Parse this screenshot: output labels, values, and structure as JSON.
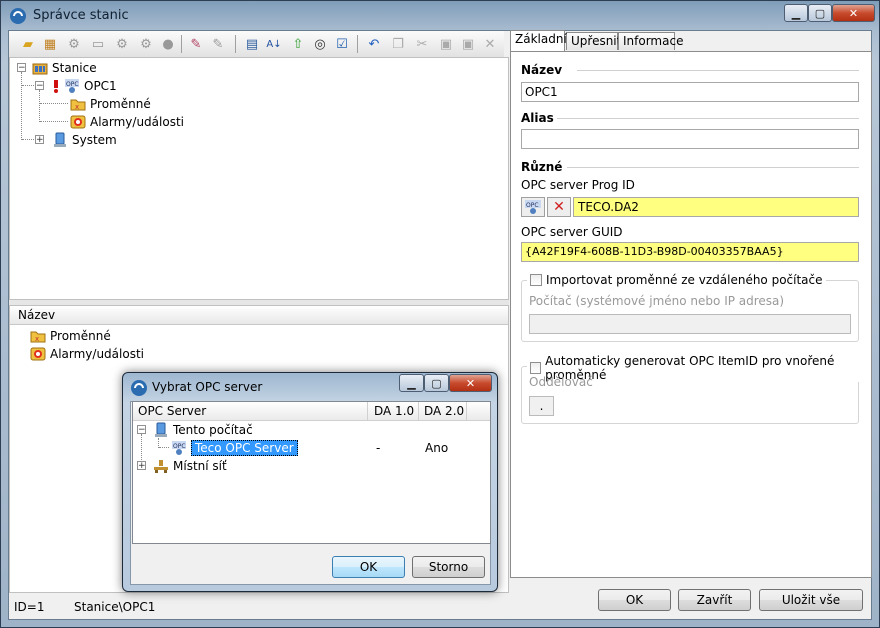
{
  "window": {
    "title": "Správce stanic"
  },
  "tree": {
    "root": "Stanice",
    "opc1": "OPC1",
    "variables": "Proměnné",
    "alarms": "Alarmy/události",
    "system": "System"
  },
  "list": {
    "header": "Název",
    "rows": [
      "Proměnné",
      "Alarmy/události"
    ]
  },
  "status": {
    "id": "ID=1",
    "path": "Stanice\\OPC1"
  },
  "tabs": [
    "Základní",
    "Upřesnit",
    "Informace"
  ],
  "props": {
    "name_section": "Název",
    "name_value": "OPC1",
    "alias_section": "Alias",
    "alias_value": "",
    "misc_section": "Různé",
    "progid_label": "OPC server Prog ID",
    "progid_value": "TECO.DA2",
    "guid_label": "OPC server GUID",
    "guid_value": "{A42F19F4-608B-11D3-B98D-00403357BAA5}",
    "import_label": "Importovat proměnné ze vzdáleného počítače",
    "computer_label": "Počítač (systémové jméno nebo IP adresa)",
    "auto_label": "Automaticky generovat OPC ItemID pro vnořené proměnné",
    "separator_label": "Oddělovač",
    "separator_value": "."
  },
  "buttons": {
    "ok": "OK",
    "close": "Zavřít",
    "save_all": "Uložit vše"
  },
  "dialog": {
    "title": "Vybrat OPC server",
    "col_server": "OPC Server",
    "col_da1": "DA 1.0",
    "col_da2": "DA 2.0",
    "this_computer": "Tento počítač",
    "server_name": "Teco OPC Server",
    "server_da1": "-",
    "server_da2": "Ano",
    "network": "Místní síť",
    "ok": "OK",
    "cancel": "Storno"
  },
  "colors": {
    "selection": "#3399ff",
    "highlight_field": "#ffff80",
    "accent": "#3c7fb1"
  }
}
